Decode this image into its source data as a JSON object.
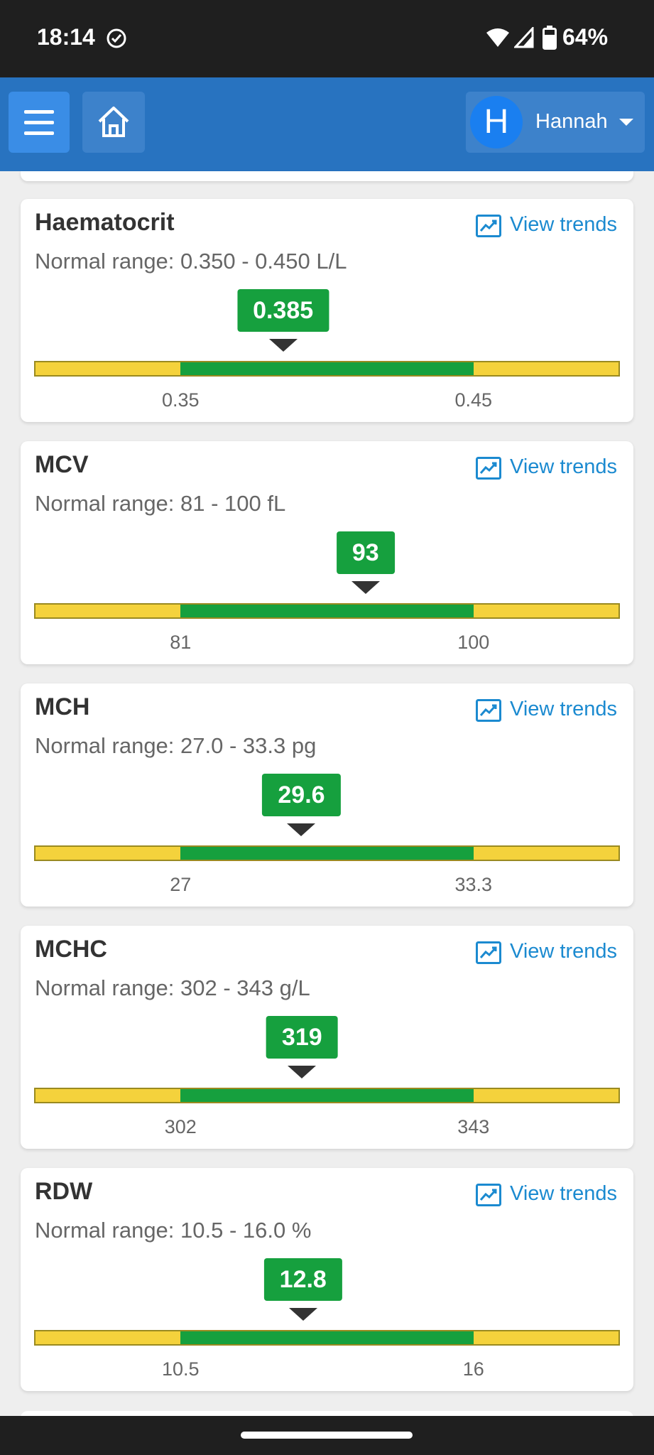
{
  "status_bar": {
    "time": "18:14",
    "battery": "64%"
  },
  "header": {
    "user_initial": "H",
    "user_name": "Hannah"
  },
  "results": [
    {
      "name": "Haematocrit",
      "range": "Normal range: 0.350 - 0.450 L/L",
      "value_label": "0.385",
      "value": 0.385,
      "low": 0.35,
      "high": 0.45,
      "low_label": "0.35",
      "high_label": "0.45",
      "trend_label": "View trends"
    },
    {
      "name": "MCV",
      "range": "Normal range: 81 - 100 fL",
      "value_label": "93",
      "value": 93,
      "low": 81,
      "high": 100,
      "low_label": "81",
      "high_label": "100",
      "trend_label": "View trends"
    },
    {
      "name": "MCH",
      "range": "Normal range: 27.0 - 33.3 pg",
      "value_label": "29.6",
      "value": 29.6,
      "low": 27.0,
      "high": 33.3,
      "low_label": "27",
      "high_label": "33.3",
      "trend_label": "View trends"
    },
    {
      "name": "MCHC",
      "range": "Normal range: 302 - 343 g/L",
      "value_label": "319",
      "value": 319,
      "low": 302,
      "high": 343,
      "low_label": "302",
      "high_label": "343",
      "trend_label": "View trends"
    },
    {
      "name": "RDW",
      "range": "Normal range: 10.5 - 16.0 %",
      "value_label": "12.8",
      "value": 12.8,
      "low": 10.5,
      "high": 16.0,
      "low_label": "10.5",
      "high_label": "16",
      "trend_label": "View trends"
    }
  ],
  "colors": {
    "app_bar": "#2873c0",
    "normal": "#16a03e",
    "out_of_range": "#f4d23c",
    "link": "#1b8ad0"
  }
}
